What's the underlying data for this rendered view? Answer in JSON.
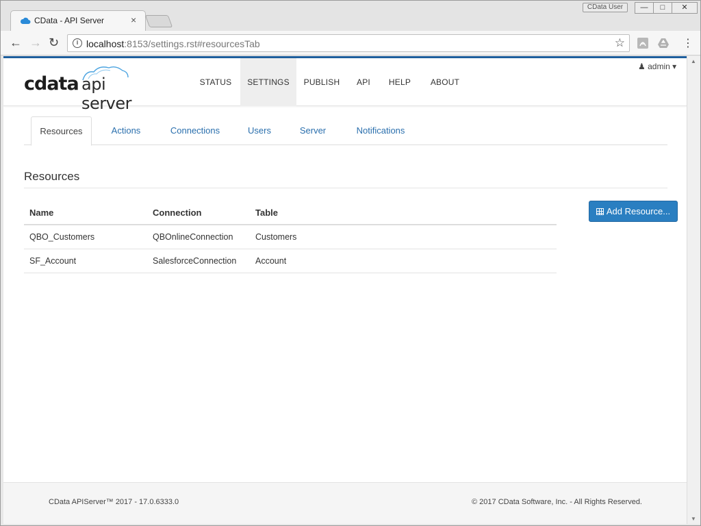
{
  "browser": {
    "tab_title": "CData - API Server",
    "tab_close": "×",
    "user_badge": "CData User",
    "window_controls": {
      "minimize": "—",
      "maximize": "□",
      "close": "✕"
    },
    "url_host": "localhost",
    "url_rest": ":8153/settings.rst#resourcesTab",
    "icons": [
      "back-icon",
      "forward-icon",
      "reload-icon",
      "info-icon",
      "star-icon",
      "pdf-extension-icon",
      "drive-extension-icon",
      "menu-icon"
    ]
  },
  "app": {
    "logo_brand": "cdata",
    "logo_product": "api server",
    "accent_color": "#1e5e9c",
    "nav": [
      {
        "label": "STATUS"
      },
      {
        "label": "SETTINGS",
        "active": true
      },
      {
        "label": "PUBLISH"
      },
      {
        "label": "API"
      },
      {
        "label": "HELP"
      },
      {
        "label": "ABOUT"
      }
    ],
    "user_menu": "admin"
  },
  "settings": {
    "tabs": [
      {
        "label": "Resources",
        "active": true
      },
      {
        "label": "Actions"
      },
      {
        "label": "Connections"
      },
      {
        "label": "Users"
      },
      {
        "label": "Server"
      },
      {
        "label": "Notifications"
      }
    ],
    "section_title": "Resources",
    "table": {
      "headers": [
        "Name",
        "Connection",
        "Table"
      ],
      "rows": [
        [
          "QBO_Customers",
          "QBOnlineConnection",
          "Customers"
        ],
        [
          "SF_Account",
          "SalesforceConnection",
          "Account"
        ]
      ]
    },
    "add_button": "Add Resource...",
    "button_color": "#2a7fc1"
  },
  "footer": {
    "left": "CData APIServer™ 2017 - 17.0.6333.0",
    "right": "© 2017 CData Software, Inc. - All Rights Reserved."
  }
}
